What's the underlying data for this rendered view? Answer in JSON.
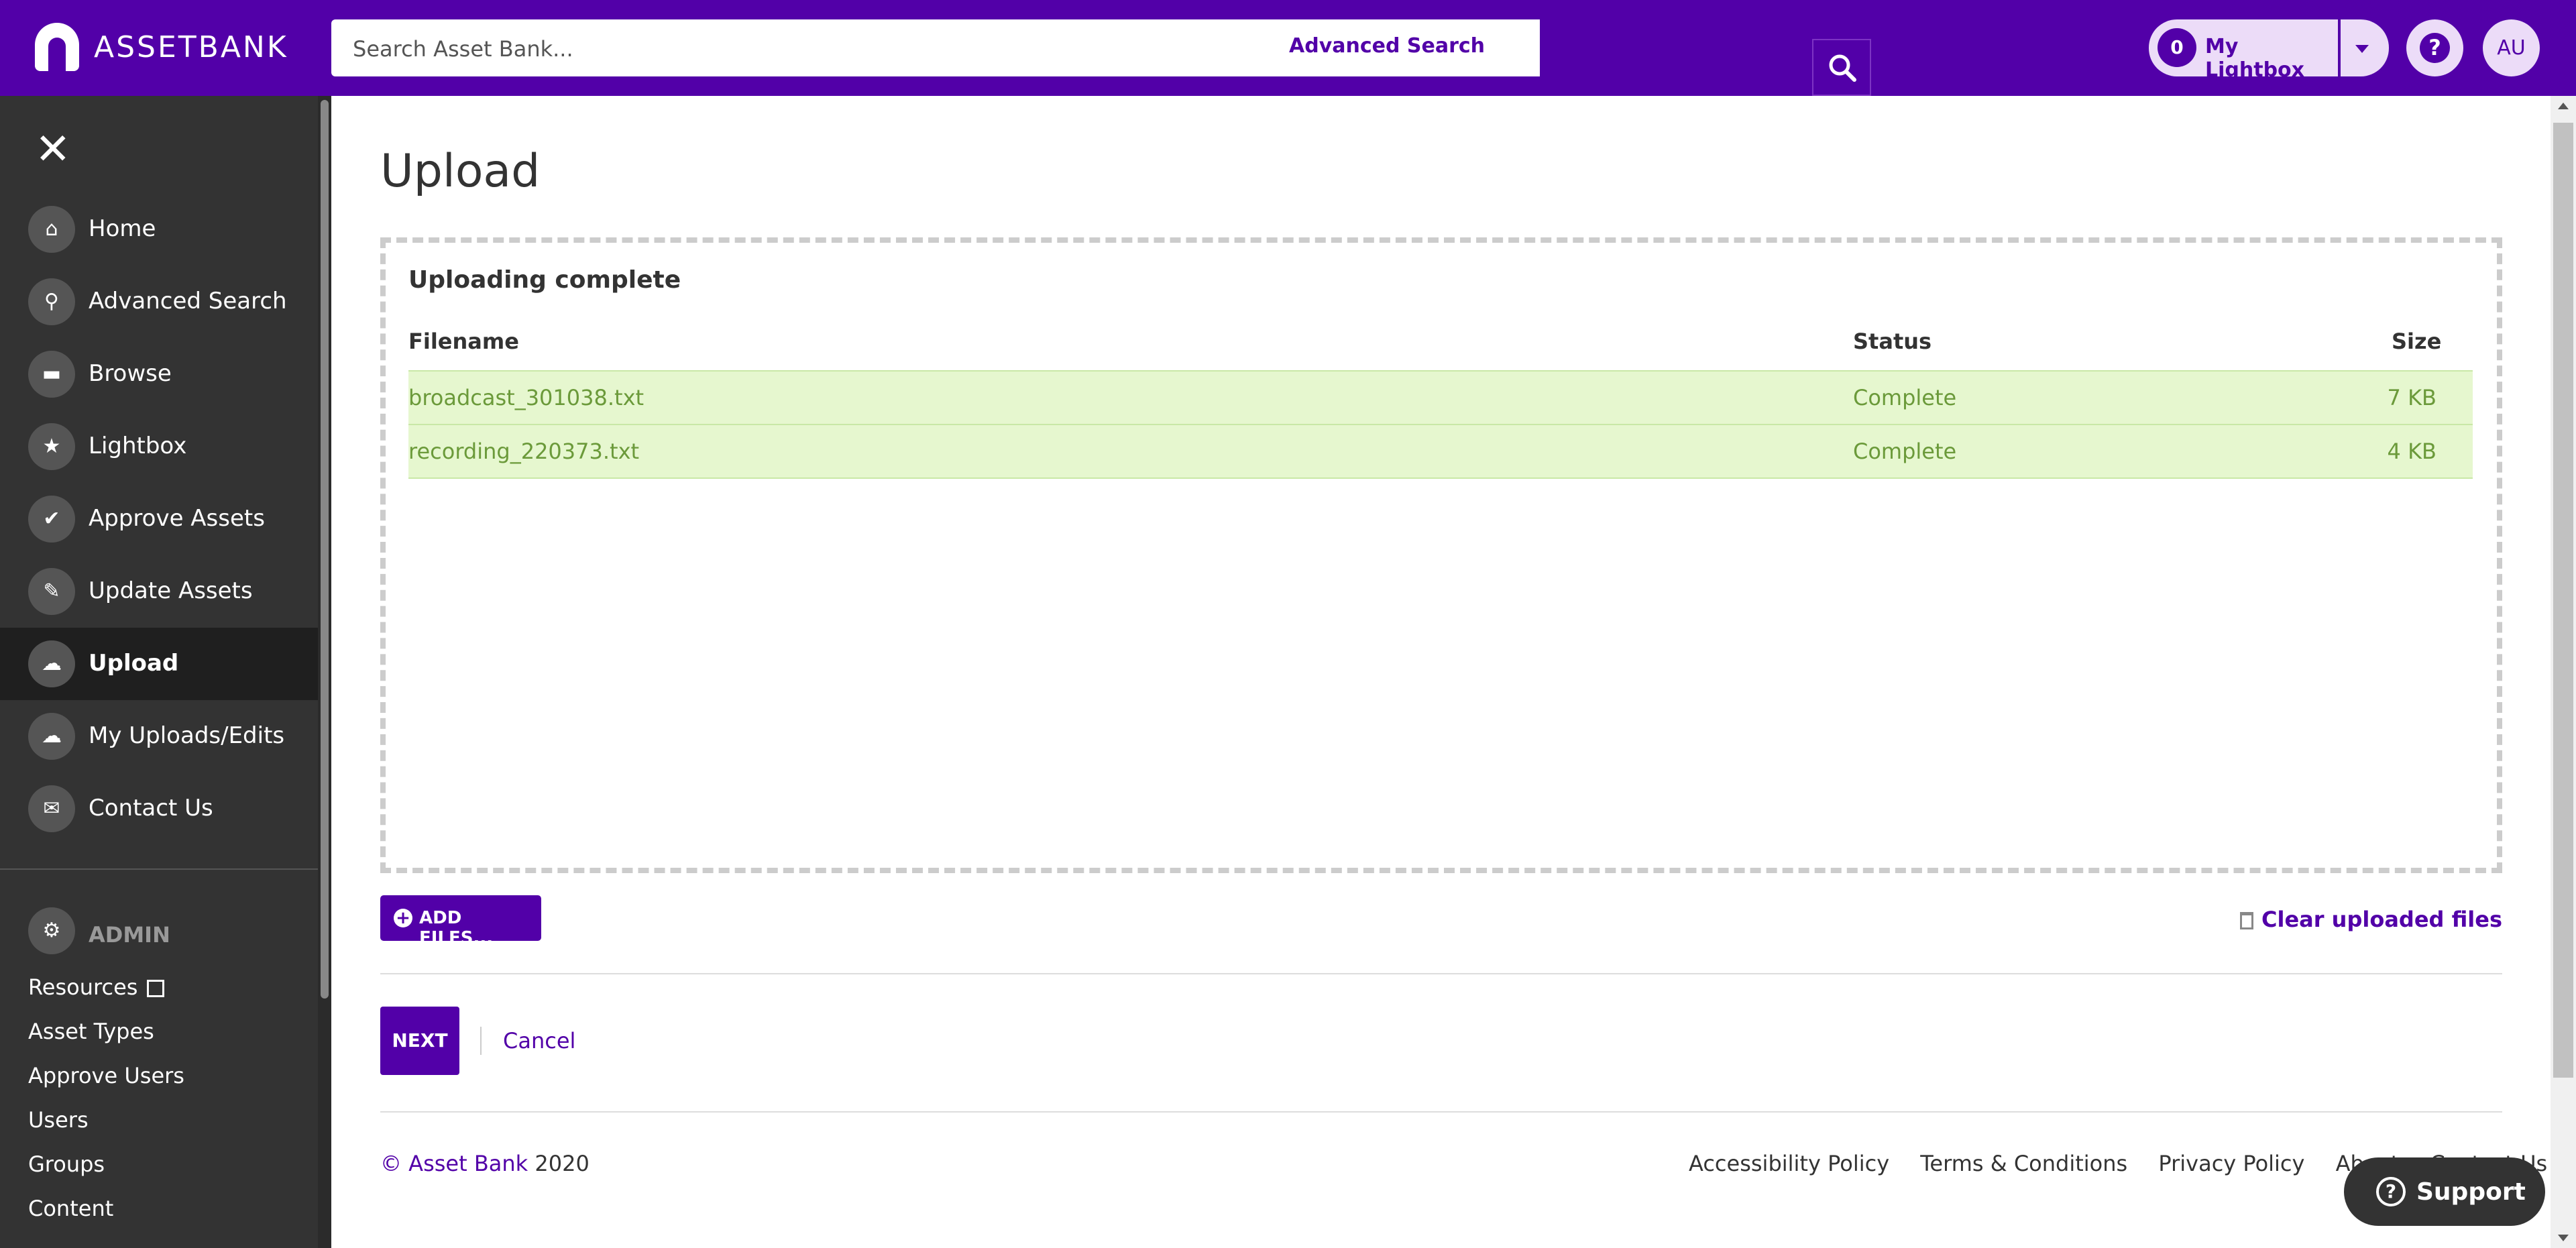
{
  "header": {
    "brand": "ASSETBANK",
    "search_placeholder": "Search Asset Bank...",
    "advanced_search": "Advanced Search",
    "lightbox_count": "0",
    "lightbox_label": "My Lightbox",
    "help": "?",
    "avatar_initials": "AU"
  },
  "sidebar": {
    "close": "✕",
    "items": [
      {
        "label": "Home",
        "icon": "home-icon"
      },
      {
        "label": "Advanced Search",
        "icon": "search-icon"
      },
      {
        "label": "Browse",
        "icon": "folder-icon"
      },
      {
        "label": "Lightbox",
        "icon": "star-icon"
      },
      {
        "label": "Approve Assets",
        "icon": "check-icon"
      },
      {
        "label": "Update Assets",
        "icon": "pencil-icon"
      },
      {
        "label": "Upload",
        "icon": "cloud-upload-icon"
      },
      {
        "label": "My Uploads/Edits",
        "icon": "cloud-icon"
      },
      {
        "label": "Contact Us",
        "icon": "chat-icon"
      }
    ],
    "active_item": "Upload",
    "admin_label": "ADMIN",
    "admin_links": [
      "Resources",
      "Asset Types",
      "Approve Users",
      "Users",
      "Groups",
      "Content"
    ]
  },
  "main": {
    "title": "Upload",
    "upload_status": "Uploading complete",
    "table": {
      "headers": {
        "filename": "Filename",
        "status": "Status",
        "size": "Size"
      },
      "rows": [
        {
          "filename": "broadcast_301038.txt",
          "status": "Complete",
          "size": "7 KB"
        },
        {
          "filename": "recording_220373.txt",
          "status": "Complete",
          "size": "4 KB"
        }
      ]
    },
    "add_files": "ADD FILES...",
    "clear_uploaded": "Clear uploaded files",
    "next": "NEXT",
    "cancel": "Cancel"
  },
  "footer": {
    "copyright_brand": "© Asset Bank",
    "copyright_year": "2020",
    "links": [
      "Accessibility Policy",
      "Terms & Conditions",
      "Privacy Policy",
      "About",
      "Contact Us"
    ]
  },
  "support": {
    "label": "Support"
  },
  "colors": {
    "brand": "#5200a8",
    "sidebar": "#333333",
    "row_complete": "#e6f7cf"
  }
}
